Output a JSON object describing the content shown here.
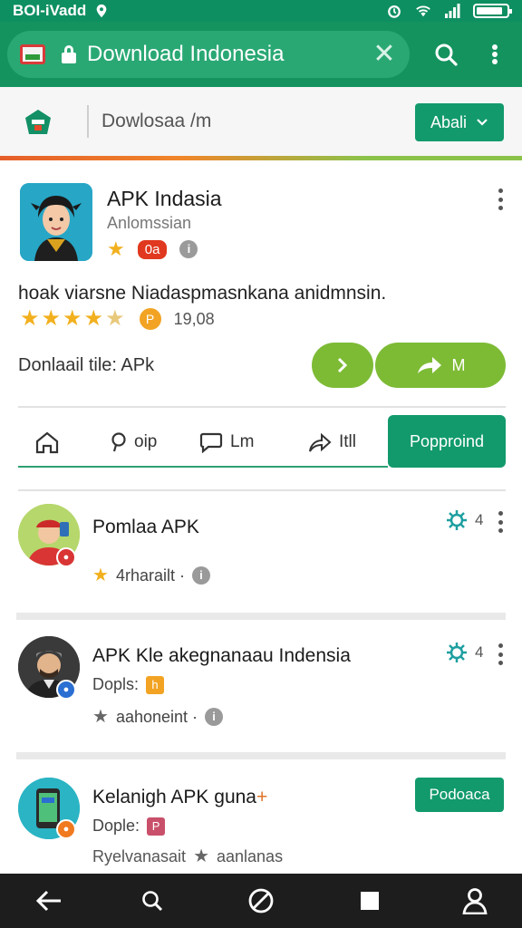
{
  "status_bar": {
    "carrier": "BOI-iVadd",
    "icons": [
      "location-icon",
      "alarm-icon",
      "wifi-icon",
      "signal-icon",
      "battery-icon"
    ]
  },
  "browser": {
    "url_text": "Download Indonesia",
    "favicon": "indonesia-flag-favicon",
    "icons": [
      "lock-icon",
      "clear-icon",
      "search-icon",
      "overflow-menu-icon"
    ]
  },
  "site_header": {
    "title": "Dowlosaa /m",
    "lang_button": "Abali",
    "icons": [
      "site-logo-icon",
      "chevron-down-icon"
    ]
  },
  "app": {
    "title": "APK Indasia",
    "developer": "Anlomssian",
    "badge": "0a",
    "description": "hoak viarsne Niadaspmasnkana anidmnsin.",
    "rating_count": "19,08",
    "rating_badge": "P",
    "download_label": "Donlaail tile: APk",
    "primary_button": "M",
    "colors": {
      "green": "#7dbb35",
      "accent": "#129a6c"
    }
  },
  "tabs": [
    {
      "label": "",
      "icon": "home-icon"
    },
    {
      "label": "oip",
      "icon": "search-icon"
    },
    {
      "label": "Lm",
      "icon": "comment-icon"
    },
    {
      "label": "Itll",
      "icon": "share-icon"
    },
    {
      "label": "Popproind",
      "active": true
    }
  ],
  "list": [
    {
      "title": "Pomlaa APK",
      "sub_text": "4rharailt ·",
      "count": "4",
      "icons": [
        "star-icon",
        "info-icon",
        "settings-icon",
        "overflow-menu-icon"
      ]
    },
    {
      "title": "APK Kle akegnanaau Indensia",
      "sub_label": "Dopls:",
      "sub_badge": "h",
      "meta_text": "aahoneint ·",
      "count": "4",
      "icons": [
        "star-icon",
        "info-icon",
        "settings-icon",
        "overflow-menu-icon"
      ]
    },
    {
      "title": "Kelanigh APK guna",
      "title_mark": "+",
      "sub_label": "Dople:",
      "sub_badge": "P",
      "meta_left": "Ryelvanasait",
      "meta_right": "aanlanas",
      "button": "Podoaca",
      "icons": [
        "star-icon"
      ]
    }
  ],
  "nav_bar": {
    "icons": [
      "back-icon",
      "search-icon",
      "block-icon",
      "square-icon",
      "profile-icon"
    ]
  }
}
